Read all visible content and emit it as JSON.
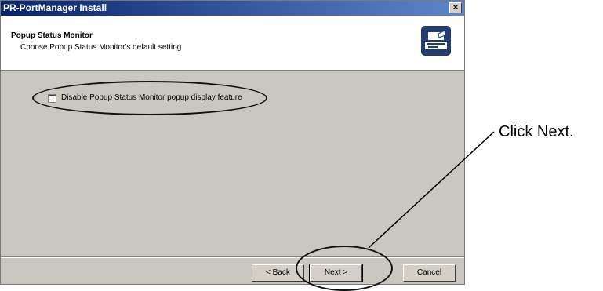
{
  "window": {
    "title": "PR-PortManager Install",
    "close_label": "×"
  },
  "header": {
    "title": "Popup Status Monitor",
    "subtitle": "Choose Popup Status Monitor's default setting",
    "icon": "printer-wizard-icon"
  },
  "options": {
    "disable_popup": {
      "label": "Disable Popup Status Monitor popup display feature",
      "checked": false
    }
  },
  "buttons": {
    "back": "< Back",
    "next": "Next >",
    "cancel": "Cancel"
  },
  "annotation": {
    "callout": "Click Next."
  }
}
